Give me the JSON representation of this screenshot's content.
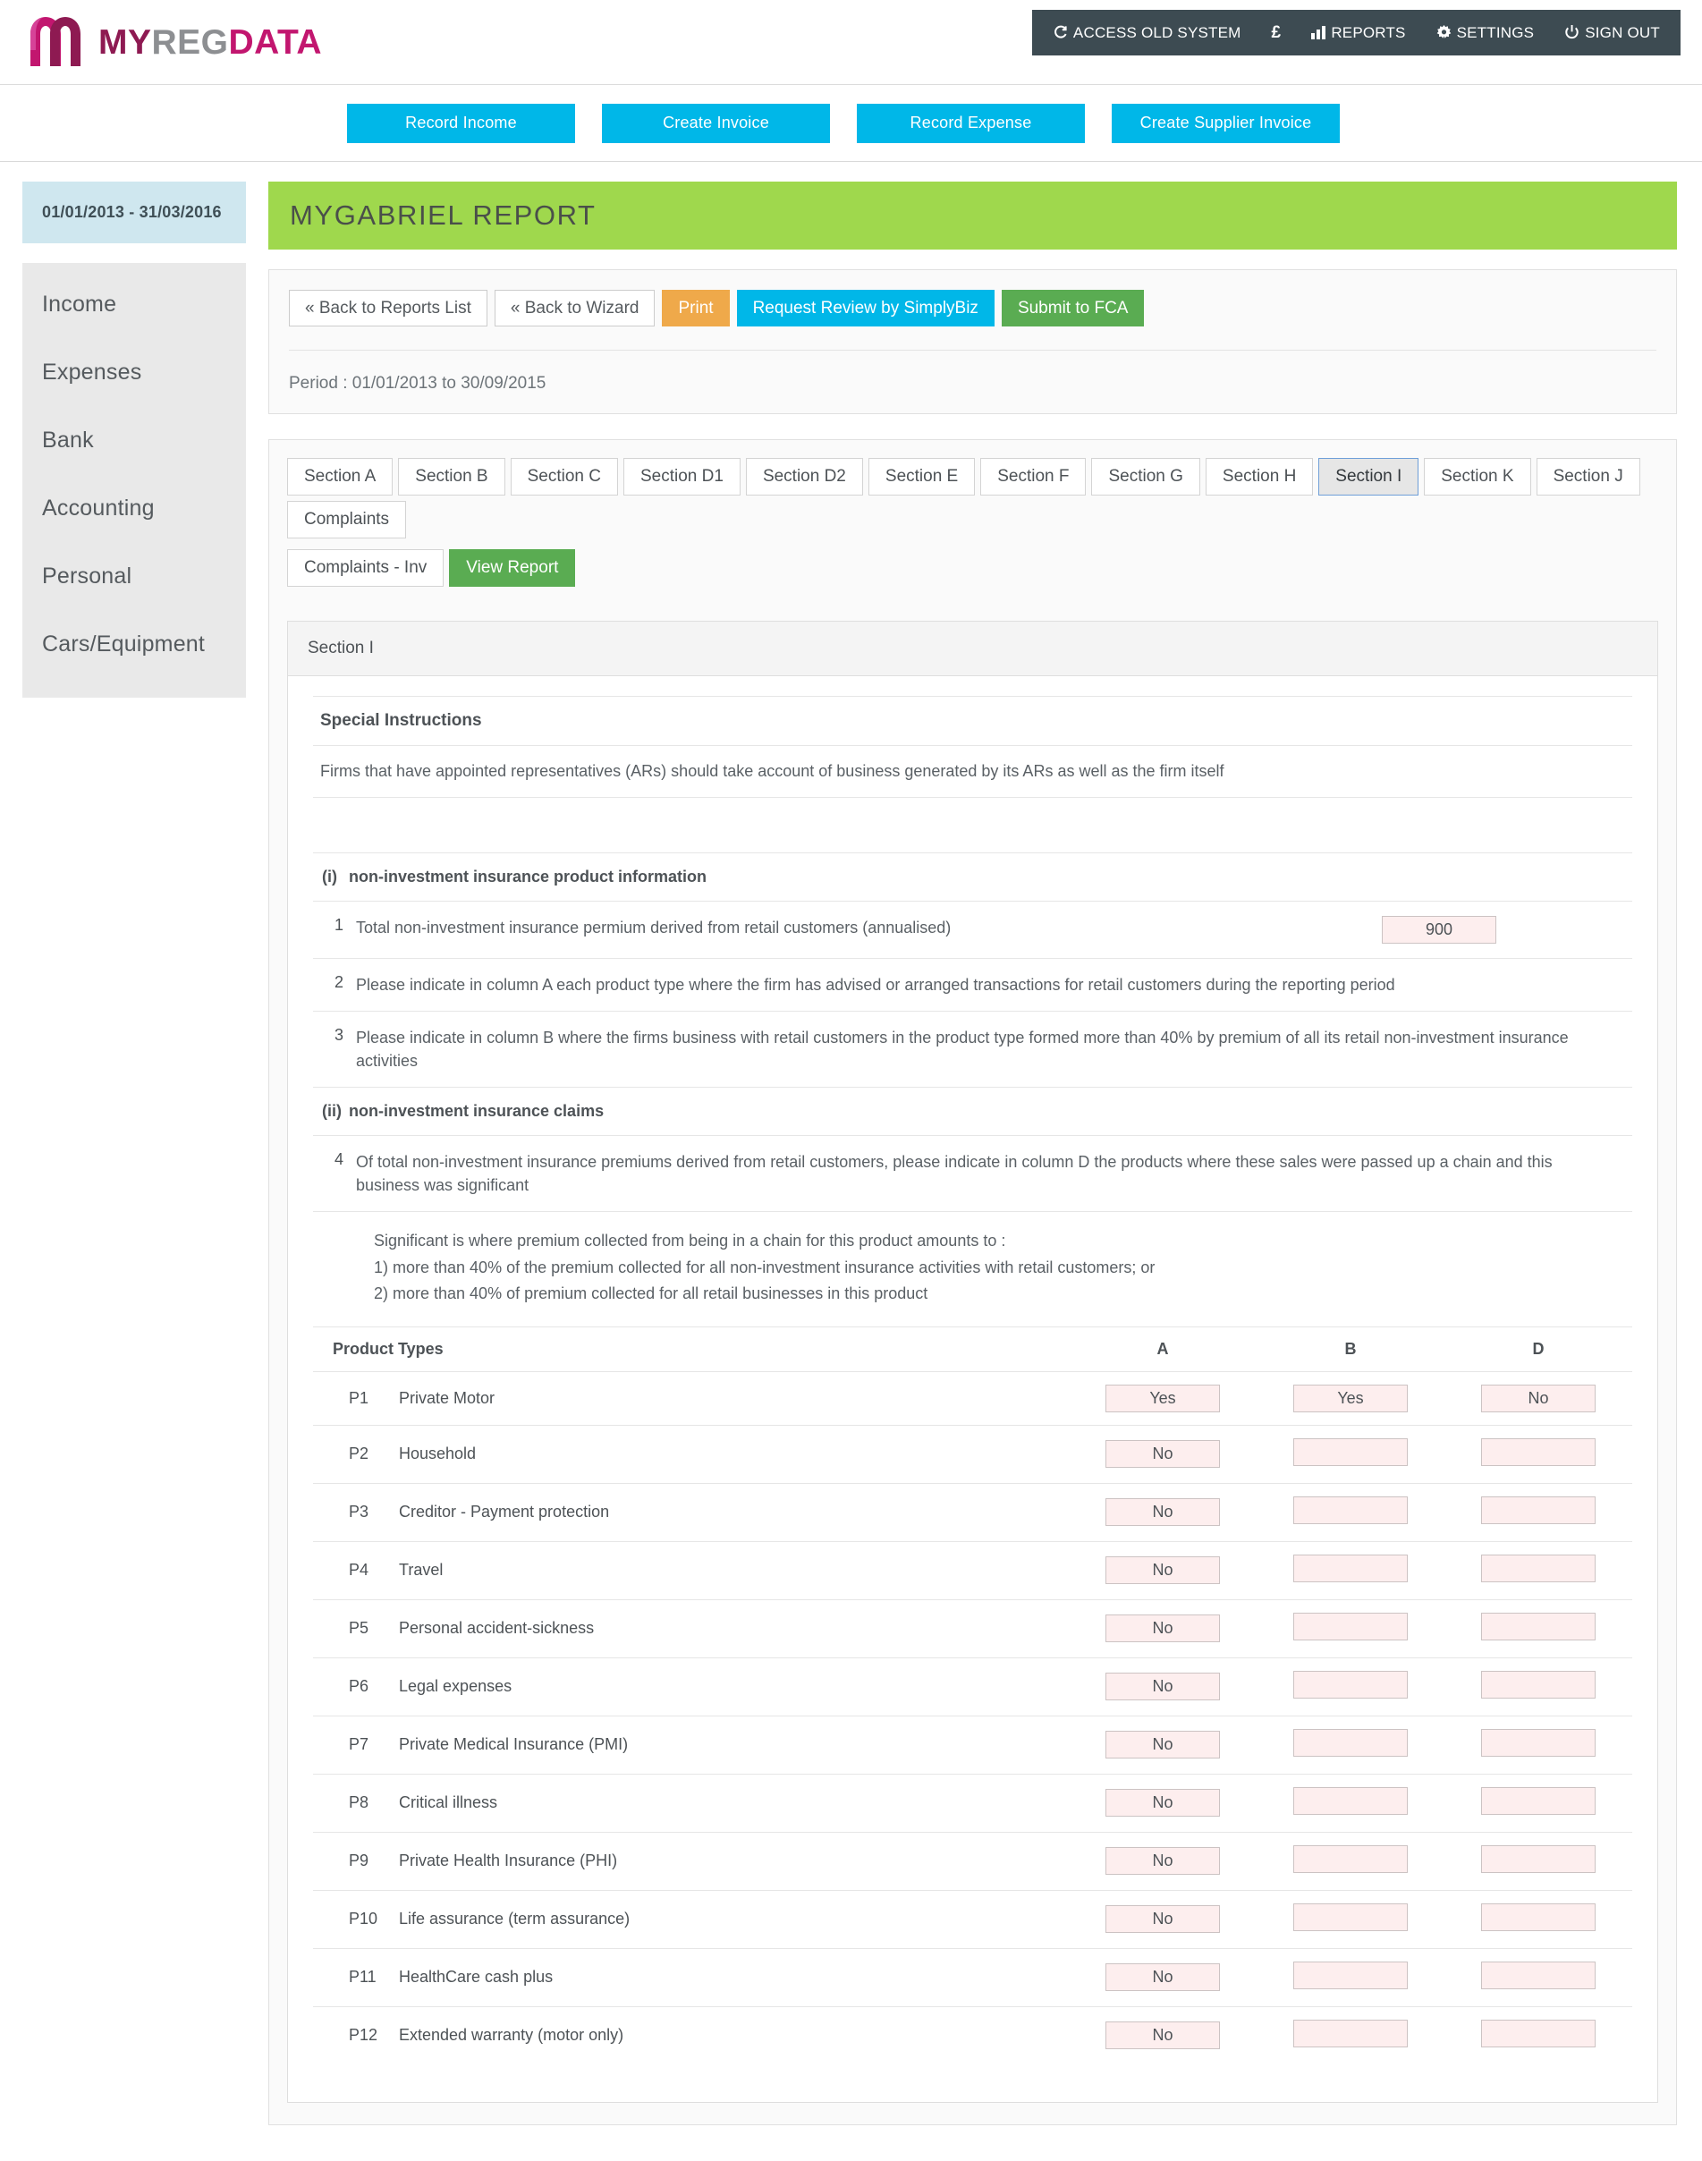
{
  "brand": {
    "my": "MY",
    "reg": "REG",
    "data": "DATA"
  },
  "usernav": [
    {
      "label": "ACCESS OLD SYSTEM",
      "icon": "refresh-icon"
    },
    {
      "label": "£",
      "icon": "currency-icon"
    },
    {
      "label": "REPORTS",
      "icon": "bar-chart-icon"
    },
    {
      "label": "SETTINGS",
      "icon": "gear-icon"
    },
    {
      "label": "SIGN OUT",
      "icon": "power-icon"
    }
  ],
  "quick_actions": [
    {
      "label": "Record Income"
    },
    {
      "label": "Create Invoice"
    },
    {
      "label": "Record Expense"
    },
    {
      "label": "Create Supplier Invoice"
    }
  ],
  "sidebar": {
    "date_range": "01/01/2013 - 31/03/2016",
    "items": [
      {
        "label": "Income"
      },
      {
        "label": "Expenses"
      },
      {
        "label": "Bank"
      },
      {
        "label": "Accounting"
      },
      {
        "label": "Personal"
      },
      {
        "label": "Cars/Equipment"
      }
    ]
  },
  "report": {
    "banner_title": "MYGABRIEL REPORT",
    "actions": [
      {
        "label": "« Back to Reports List",
        "style": "default"
      },
      {
        "label": "« Back to Wizard",
        "style": "default"
      },
      {
        "label": "Print",
        "style": "orange"
      },
      {
        "label": "Request Review by SimplyBiz",
        "style": "cyan"
      },
      {
        "label": "Submit to FCA",
        "style": "green"
      }
    ],
    "period": "Period : 01/01/2013 to 30/09/2015"
  },
  "tabs": [
    {
      "label": "Section A",
      "active": false
    },
    {
      "label": "Section B",
      "active": false
    },
    {
      "label": "Section C",
      "active": false
    },
    {
      "label": "Section D1",
      "active": false
    },
    {
      "label": "Section D2",
      "active": false
    },
    {
      "label": "Section E",
      "active": false
    },
    {
      "label": "Section F",
      "active": false
    },
    {
      "label": "Section G",
      "active": false
    },
    {
      "label": "Section H",
      "active": false
    },
    {
      "label": "Section I",
      "active": true
    },
    {
      "label": "Section K",
      "active": false
    },
    {
      "label": "Section J",
      "active": false
    },
    {
      "label": "Complaints",
      "active": false
    },
    {
      "label": "Complaints - Inv",
      "active": false
    }
  ],
  "view_report_label": "View Report",
  "section": {
    "card_title": "Section I",
    "special_instructions_label": "Special Instructions",
    "special_instructions_text": "Firms that have appointed representatives (ARs) should take account of business generated by its ARs as well as the firm itself",
    "group_i": {
      "roman": "(i)",
      "title": "non-investment insurance product information",
      "rows": [
        {
          "num": "1",
          "text": "Total non-investment insurance permium derived from retail customers (annualised)",
          "value": "900",
          "has_value": true
        },
        {
          "num": "2",
          "text": "Please indicate in column A each product type where the firm has advised or arranged transactions for retail customers during the reporting period",
          "value": "",
          "has_value": false
        },
        {
          "num": "3",
          "text": "Please indicate in column B where the firms business with retail customers in the product type formed more than 40% by premium of all its retail non-investment insurance activities",
          "value": "",
          "has_value": false
        }
      ]
    },
    "group_ii": {
      "roman": "(ii)",
      "title": "non-investment insurance claims",
      "rows": [
        {
          "num": "4",
          "text": "Of total non-investment insurance premiums derived from retail customers, please indicate in column D the products where these sales were passed up a chain and this business was significant"
        }
      ],
      "note_line1": "Significant is where premium collected from being in a chain for this product amounts to :",
      "note_line2": "1) more than 40% of the premium collected for all non-investment insurance activities with retail customers; or",
      "note_line3": "2) more than 40% of premium collected for all retail businesses in this product"
    },
    "table": {
      "header": {
        "label": "Product Types",
        "col_a": "A",
        "col_b": "B",
        "col_d": "D"
      },
      "rows": [
        {
          "code": "P1",
          "name": "Private Motor",
          "a": "Yes",
          "b": "Yes",
          "d": "No"
        },
        {
          "code": "P2",
          "name": "Household",
          "a": "No",
          "b": "",
          "d": ""
        },
        {
          "code": "P3",
          "name": "Creditor - Payment protection",
          "a": "No",
          "b": "",
          "d": ""
        },
        {
          "code": "P4",
          "name": "Travel",
          "a": "No",
          "b": "",
          "d": ""
        },
        {
          "code": "P5",
          "name": "Personal accident-sickness",
          "a": "No",
          "b": "",
          "d": ""
        },
        {
          "code": "P6",
          "name": "Legal expenses",
          "a": "No",
          "b": "",
          "d": ""
        },
        {
          "code": "P7",
          "name": "Private Medical Insurance (PMI)",
          "a": "No",
          "b": "",
          "d": ""
        },
        {
          "code": "P8",
          "name": "Critical illness",
          "a": "No",
          "b": "",
          "d": ""
        },
        {
          "code": "P9",
          "name": "Private Health Insurance (PHI)",
          "a": "No",
          "b": "",
          "d": ""
        },
        {
          "code": "P10",
          "name": "Life assurance (term assurance)",
          "a": "No",
          "b": "",
          "d": ""
        },
        {
          "code": "P11",
          "name": "HealthCare cash plus",
          "a": "No",
          "b": "",
          "d": ""
        },
        {
          "code": "P12",
          "name": "Extended warranty (motor only)",
          "a": "No",
          "b": "",
          "d": ""
        }
      ]
    }
  },
  "colors": {
    "accent_cyan": "#00b7e8",
    "banner_green": "#9fd84d",
    "button_green": "#5aac52",
    "button_orange": "#efa94a",
    "nav_dark": "#3d4b52",
    "date_blue": "#cfe7ef",
    "input_pink": "#fdeeee"
  }
}
